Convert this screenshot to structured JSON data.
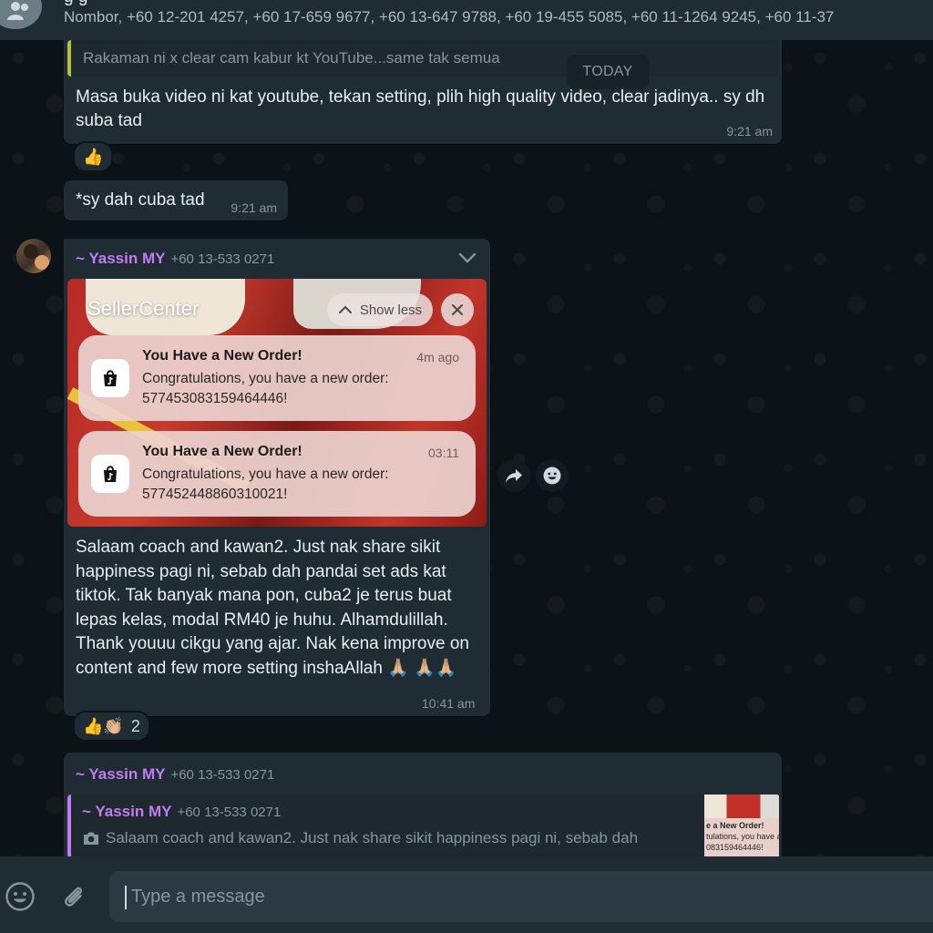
{
  "header": {
    "title_fragment": "g g",
    "participants": "Nombor, +60 12-201 4257, +60 17-659 9677, +60 13-647 9788, +60 19-455 5085, +60 11-1264 9245, +60 11-37"
  },
  "date_separator": "TODAY",
  "messages": {
    "m1": {
      "quote_text": "Rakaman ni x clear cam kabur kt YouTube...same tak semua",
      "text": "Masa buka video ni kat youtube, tekan setting, plih high quality video, clear jadinya.. sy dh suba tad",
      "time": "9:21 am",
      "reaction": "👍"
    },
    "m2": {
      "text": "*sy dah cuba tad",
      "time": "9:21 am"
    },
    "m3": {
      "sender": "~ Yassin MY",
      "phone": "+60 13-533 0271",
      "image": {
        "brand": "SellerCenter",
        "show_less": "Show less",
        "notifications": [
          {
            "title": "You Have a New Order!",
            "time": "4m ago",
            "body": "Congratulations, you have a new order: 577453083159464446!"
          },
          {
            "title": "You Have a New Order!",
            "time": "03:11",
            "body": "Congratulations, you have a new order: 577452448860310021!"
          }
        ]
      },
      "text": "Salaam coach and kawan2. Just nak share sikit happiness pagi ni, sebab dah pandai set ads kat tiktok. Tak banyak mana pon, cuba2 je terus buat lepas kelas, modal RM40 je huhu. Alhamdulillah. Thank youuu cikgu yang ajar. Nak kena improve on content and few more setting inshaAllah 🙏🏼 🙏🏼🙏🏼",
      "time": "10:41 am",
      "reactions": "👍👏🏼",
      "reaction_count": "2"
    },
    "m4": {
      "sender": "~ Yassin MY",
      "phone": "+60 13-533 0271",
      "quote_sender": "~ Yassin MY",
      "quote_phone": "+60 13-533 0271",
      "quote_text": "Salaam coach and kawan2. Just nak share sikit happiness pagi ni, sebab dah",
      "thumb_lines": [
        "e a New Order!",
        "tulations, you have a ne",
        "083159464446!"
      ]
    }
  },
  "composer": {
    "placeholder": "Type a message"
  },
  "colors": {
    "sender": "#c07cf0",
    "quote_bar_m1": "#b6c23a",
    "quote_bar_m4": "#c07cf0",
    "bubble": "#202c33",
    "background": "#0b141a"
  },
  "icons": [
    "group-avatar-icon",
    "chevron-down-icon",
    "chevron-up-icon",
    "close-icon",
    "tiktok-shop-icon",
    "forward-icon",
    "emoji-icon",
    "attach-icon",
    "camera-icon"
  ]
}
